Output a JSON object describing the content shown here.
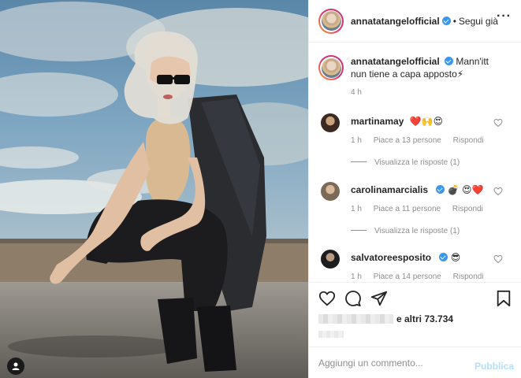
{
  "post": {
    "author": "annatatangelofficial",
    "follow_status": "Segui già",
    "separator": "•",
    "more_icon": "more-horizontal-icon"
  },
  "caption": {
    "username": "annatatangelofficial",
    "text": "Mann'itt nun tiene a capa apposto⚡",
    "time": "4 h"
  },
  "comments": [
    {
      "username": "martinamay",
      "text": "❤️🙌😍",
      "time": "1 h",
      "likes": "Piace a 13 persone",
      "reply": "Rispondi",
      "view_replies": "Visualizza le risposte (1)",
      "verified": false
    },
    {
      "username": "carolinamarcialis",
      "text": "💣 😍❤️",
      "time": "1 h",
      "likes": "Piace a 11 persone",
      "reply": "Rispondi",
      "view_replies": "Visualizza le risposte (1)",
      "verified": true
    },
    {
      "username": "salvatoreesposito",
      "text": "😎",
      "time": "1 h",
      "likes": "Piace a 14 persone",
      "reply": "Rispondi",
      "view_replies": "",
      "verified": true
    }
  ],
  "actions": {
    "like_icon": "heart-icon",
    "comment_icon": "comment-icon",
    "share_icon": "share-icon",
    "save_icon": "bookmark-icon"
  },
  "likes": {
    "text": "e altri 73.734"
  },
  "add_comment": {
    "placeholder": "Aggiungi un commento...",
    "publish_label": "Pubblica"
  },
  "colors": {
    "accent": "#3897f0",
    "publish_disabled": "#b2dffc",
    "meta_gray": "#8e8e8e"
  }
}
